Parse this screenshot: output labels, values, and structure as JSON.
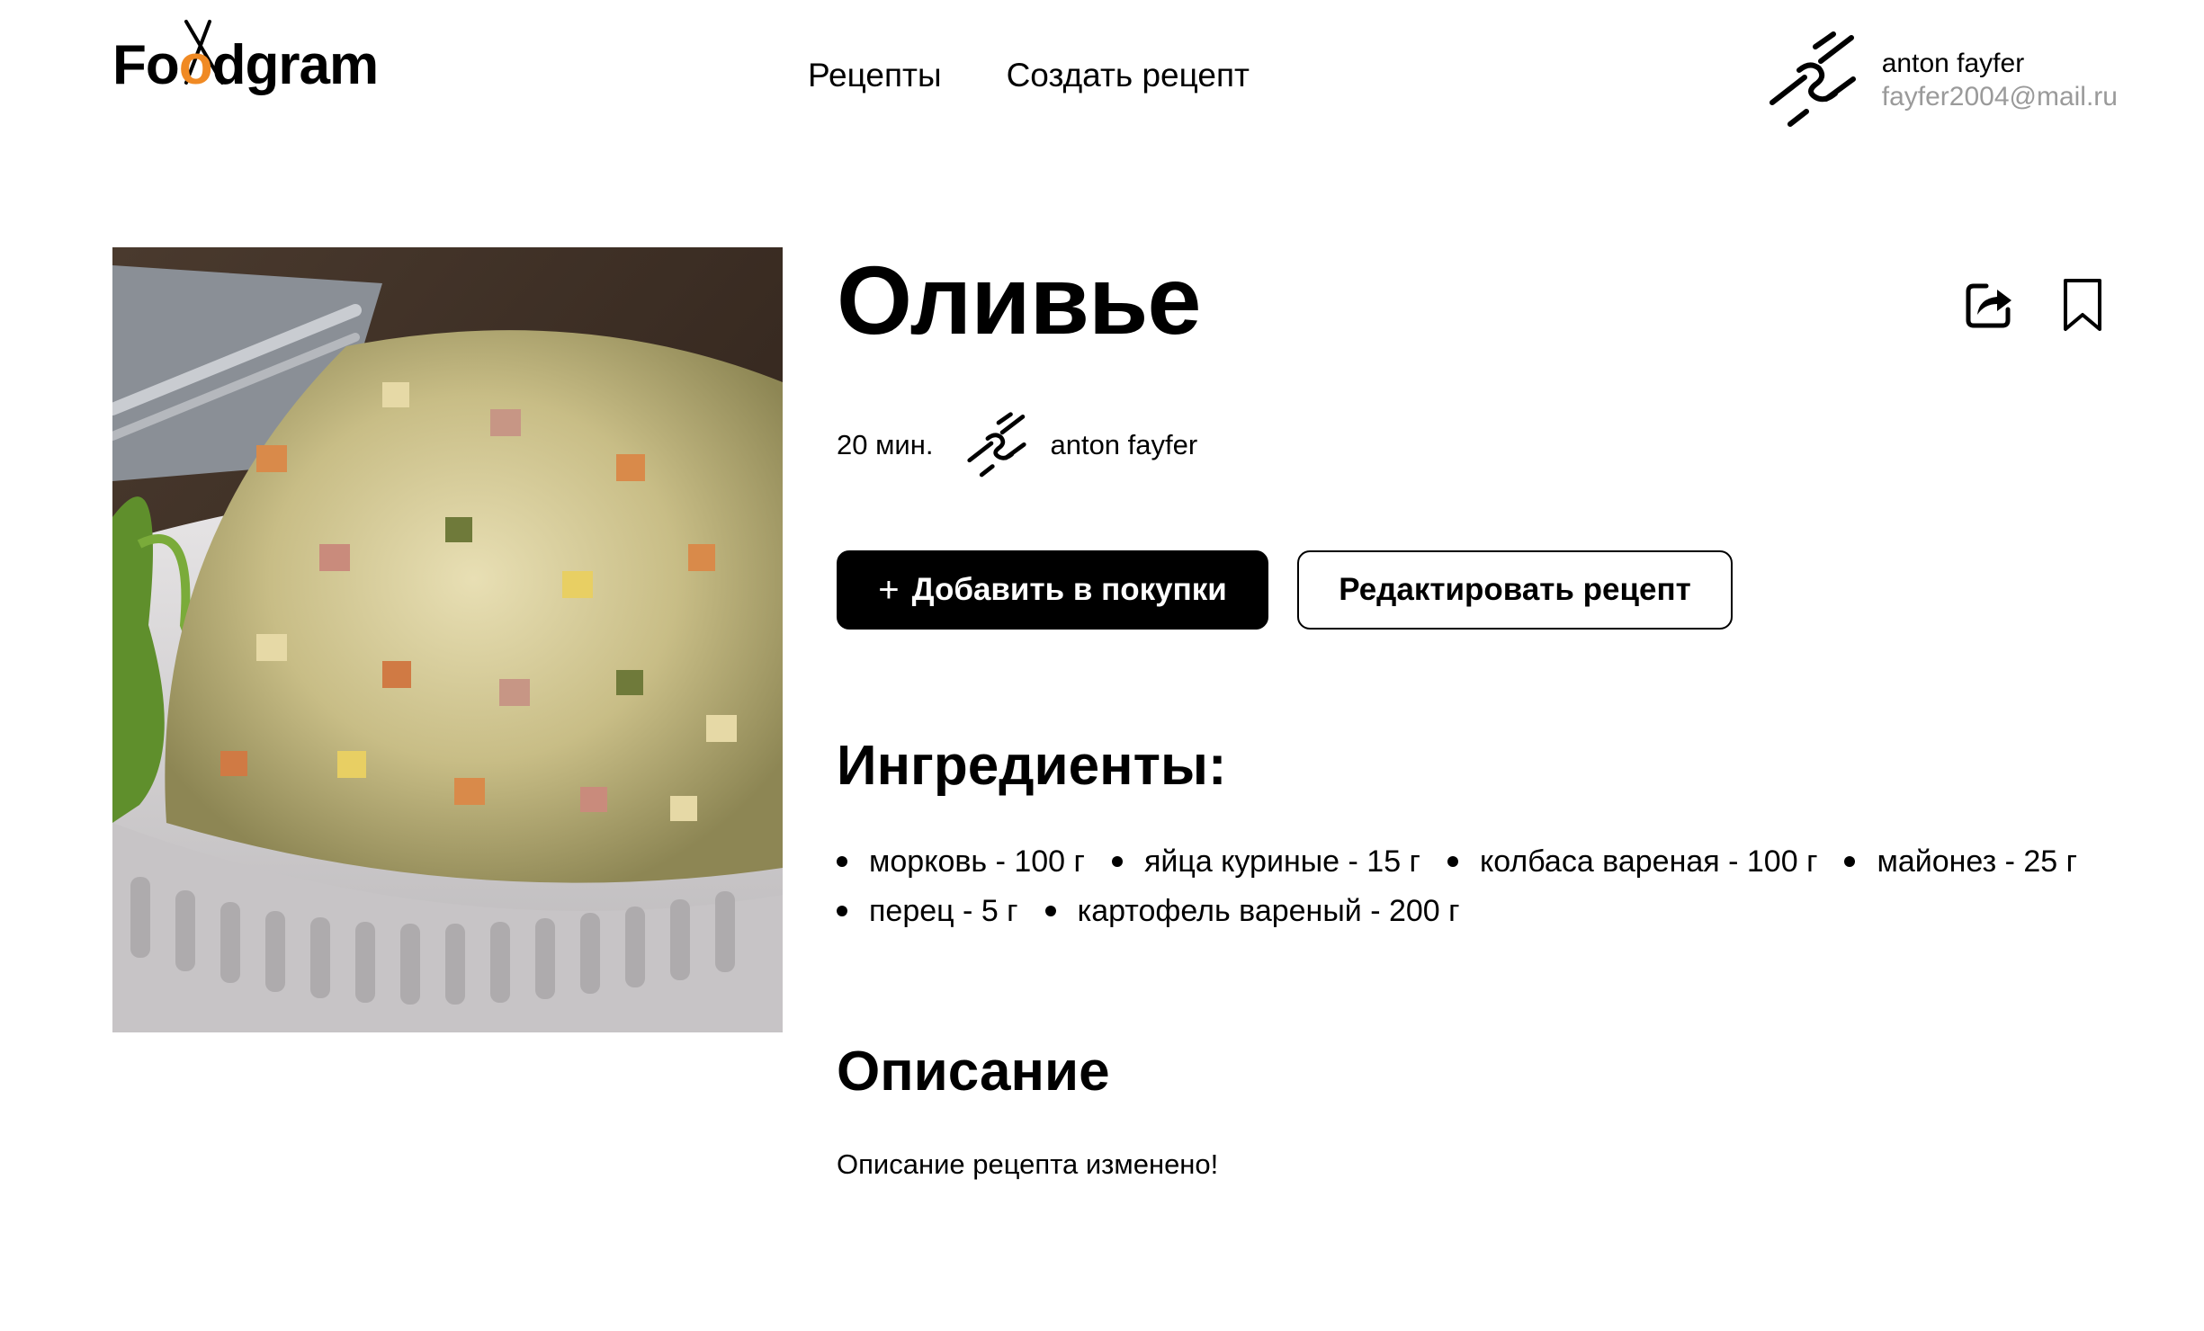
{
  "header": {
    "logo": {
      "text_before": "Fo",
      "text_o": "o",
      "text_after": "dgram"
    },
    "nav": [
      {
        "label": "Рецепты"
      },
      {
        "label": "Создать рецепт"
      }
    ],
    "user": {
      "name": "anton fayfer",
      "email": "fayfer2004@mail.ru",
      "avatar_icon": "chain-link-icon"
    }
  },
  "recipe": {
    "title": "Оливье",
    "image_alt": "olivier-salad-photo",
    "time": "20 мин.",
    "author": "anton fayfer",
    "actions": {
      "share_icon": "share-icon",
      "bookmark_icon": "bookmark-icon"
    },
    "buttons": {
      "add_to_cart_plus": "+",
      "add_to_cart": "Добавить в покупки",
      "edit": "Редактировать рецепт"
    },
    "ingredients_heading": "Ингредиенты:",
    "ingredients": [
      "морковь - 100 г",
      "яйца куриные - 15 г",
      "колбаса вареная - 100 г",
      "майонез - 25 г",
      "перец - 5 г",
      "картофель вареный - 200 г"
    ],
    "description_heading": "Описание",
    "description": "Описание рецепта изменено!"
  },
  "colors": {
    "accent": "#f08a24",
    "text": "#000000",
    "muted": "#9a9a9a",
    "background": "#ffffff"
  }
}
